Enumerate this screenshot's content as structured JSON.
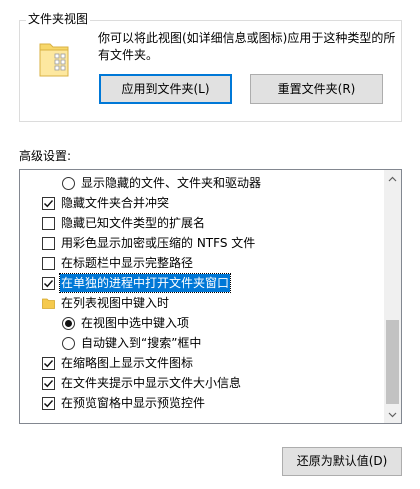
{
  "folder_view": {
    "title": "文件夹视图",
    "description": "你可以将此视图(如详细信息或图标)应用于这种类型的所有文件夹。",
    "apply_button": "应用到文件夹(L)",
    "reset_button": "重置文件夹(R)"
  },
  "advanced": {
    "label": "高级设置:",
    "items": [
      {
        "type": "radio",
        "checked": false,
        "indent": 2,
        "label": "显示隐藏的文件、文件夹和驱动器"
      },
      {
        "type": "checkbox",
        "checked": true,
        "indent": 1,
        "label": "隐藏文件夹合并冲突"
      },
      {
        "type": "checkbox",
        "checked": false,
        "indent": 1,
        "label": "隐藏已知文件类型的扩展名"
      },
      {
        "type": "checkbox",
        "checked": false,
        "indent": 1,
        "label": "用彩色显示加密或压缩的 NTFS 文件"
      },
      {
        "type": "checkbox",
        "checked": false,
        "indent": 1,
        "label": "在标题栏中显示完整路径"
      },
      {
        "type": "checkbox",
        "checked": true,
        "indent": 1,
        "label": "在单独的进程中打开文件夹窗口",
        "selected": true
      },
      {
        "type": "folder",
        "indent": 1,
        "label": "在列表视图中键入时"
      },
      {
        "type": "radio",
        "checked": true,
        "indent": 2,
        "label": "在视图中选中键入项"
      },
      {
        "type": "radio",
        "checked": false,
        "indent": 2,
        "label": "自动键入到“搜索”框中"
      },
      {
        "type": "checkbox",
        "checked": true,
        "indent": 1,
        "label": "在缩略图上显示文件图标"
      },
      {
        "type": "checkbox",
        "checked": true,
        "indent": 1,
        "label": "在文件夹提示中显示文件大小信息"
      },
      {
        "type": "checkbox",
        "checked": true,
        "indent": 1,
        "label": "在预览窗格中显示预览控件"
      }
    ],
    "scroll_up_icon": "chevron-up-icon",
    "scroll_down_icon": "chevron-down-icon"
  },
  "restore_button": "还原为默认值(D)",
  "colors": {
    "selection": "#0078d7",
    "button_bg": "#e1e1e1",
    "primary_border": "#0078d7"
  }
}
